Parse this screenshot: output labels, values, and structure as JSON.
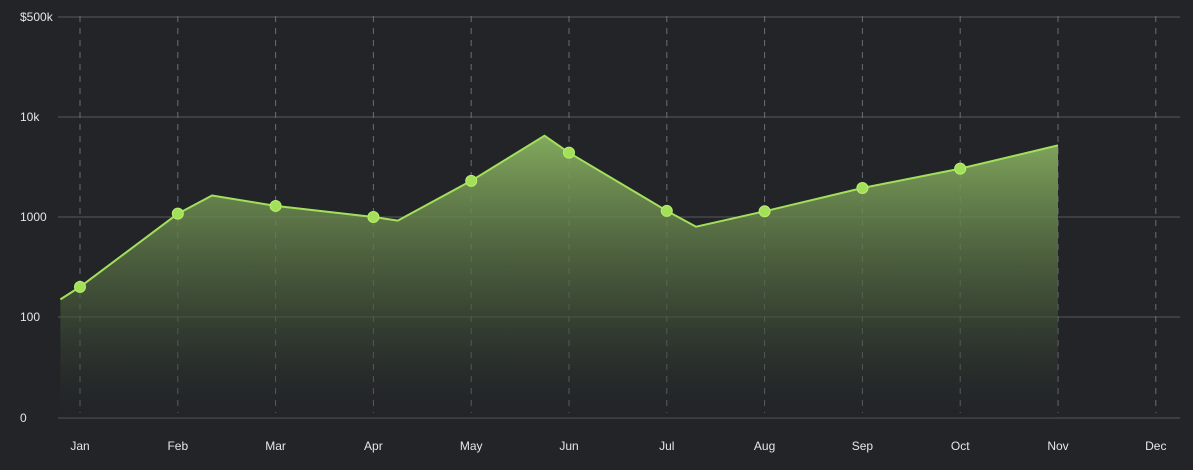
{
  "chart_data": {
    "type": "area",
    "title": "",
    "xlabel": "",
    "ylabel": "",
    "y_scale": "log",
    "y_ticks": [
      {
        "value": 0,
        "label": "0"
      },
      {
        "value": 100,
        "label": "100"
      },
      {
        "value": 1000,
        "label": "1000"
      },
      {
        "value": 10000,
        "label": "10k"
      },
      {
        "value": 100000,
        "label": "$500k"
      }
    ],
    "categories": [
      "Jan",
      "Feb",
      "Mar",
      "Apr",
      "May",
      "Jun",
      "Jul",
      "Aug",
      "Sep",
      "Oct",
      "Nov",
      "Dec"
    ],
    "grid": true,
    "legend": "none",
    "colors": {
      "background": "#222428",
      "line": "#a3e05a",
      "marker": "#a3e05a",
      "fill_top": "#88b060",
      "fill_bottom": "#222428"
    },
    "line_points": [
      {
        "month": 0.8,
        "value": 150
      },
      {
        "month": 1.0,
        "value": 200
      },
      {
        "month": 2.0,
        "value": 1080
      },
      {
        "month": 2.35,
        "value": 1640
      },
      {
        "month": 3.0,
        "value": 1290
      },
      {
        "month": 4.0,
        "value": 1000
      },
      {
        "month": 4.25,
        "value": 920
      },
      {
        "month": 5.0,
        "value": 2300
      },
      {
        "month": 5.75,
        "value": 6500
      },
      {
        "month": 6.0,
        "value": 4400
      },
      {
        "month": 7.0,
        "value": 1150
      },
      {
        "month": 7.3,
        "value": 800
      },
      {
        "month": 8.0,
        "value": 1140
      },
      {
        "month": 9.0,
        "value": 1950
      },
      {
        "month": 10.0,
        "value": 3050
      },
      {
        "month": 11.0,
        "value": 5200
      }
    ],
    "markers": [
      {
        "category": "Jan",
        "value": 200
      },
      {
        "category": "Feb",
        "value": 1080
      },
      {
        "category": "Mar",
        "value": 1290
      },
      {
        "category": "Apr",
        "value": 1000
      },
      {
        "category": "May",
        "value": 2300
      },
      {
        "category": "Jun",
        "value": 4400
      },
      {
        "category": "Jul",
        "value": 1150
      },
      {
        "category": "Aug",
        "value": 1140
      },
      {
        "category": "Sep",
        "value": 1950
      },
      {
        "category": "Oct",
        "value": 3050
      }
    ]
  }
}
